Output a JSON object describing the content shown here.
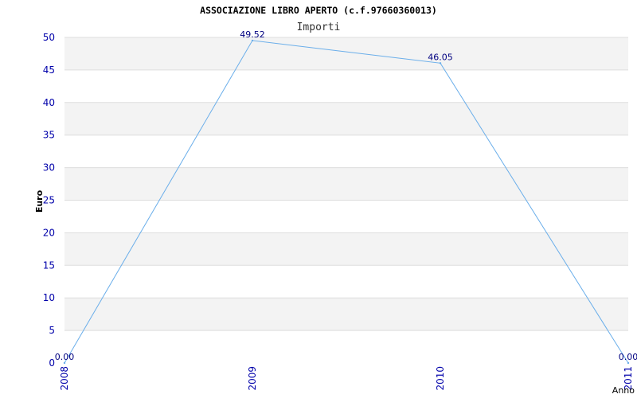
{
  "header": {
    "title": "ASSOCIAZIONE LIBRO APERTO (c.f.97660360013)",
    "subtitle": "Importi"
  },
  "chart_data": {
    "type": "line",
    "title": "ASSOCIAZIONE LIBRO APERTO (c.f.97660360013)",
    "subtitle": "Importi",
    "xlabel": "Anno",
    "ylabel": "Euro",
    "categories": [
      "2008",
      "2009",
      "2010",
      "2011"
    ],
    "series": [
      {
        "values": [
          0.0,
          49.52,
          46.05,
          0.0
        ],
        "labels": [
          "0.00",
          "49.52",
          "46.05",
          "0.00"
        ]
      }
    ],
    "ylim": [
      0,
      50
    ],
    "yticks": [
      "0",
      "5",
      "10",
      "15",
      "20",
      "25",
      "30",
      "35",
      "40",
      "45",
      "50"
    ],
    "grid": true,
    "colors": {
      "line": "#6aaeea",
      "tick_text": "#0000aa",
      "data_label": "#000080",
      "band": "#f3f3f3",
      "gridline": "#dddddd"
    }
  }
}
